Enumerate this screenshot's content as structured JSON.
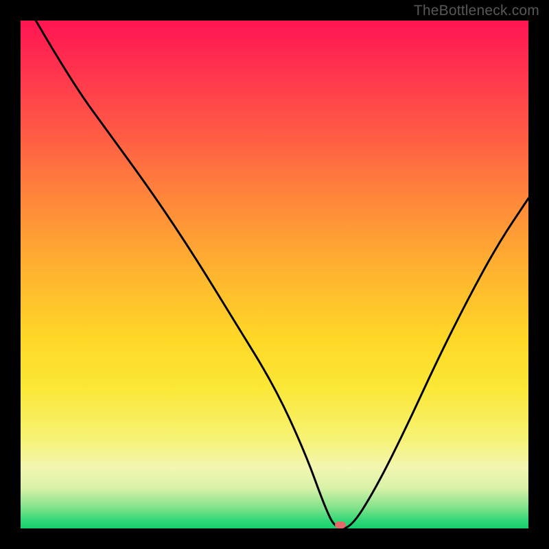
{
  "watermark": "TheBottleneck.com",
  "marker": {
    "x_pct": 63,
    "y_pct": 99.3
  },
  "chart_data": {
    "type": "line",
    "title": "",
    "xlabel": "",
    "ylabel": "",
    "xlim": [
      0,
      100
    ],
    "ylim": [
      0,
      100
    ],
    "background_gradient": {
      "orientation": "vertical",
      "stops": [
        {
          "pct": 0,
          "color": "#ff1552"
        },
        {
          "pct": 22,
          "color": "#ff5a45"
        },
        {
          "pct": 50,
          "color": "#ffb52f"
        },
        {
          "pct": 72,
          "color": "#fbe735"
        },
        {
          "pct": 92,
          "color": "#d9f2a8"
        },
        {
          "pct": 100,
          "color": "#16d06f"
        }
      ]
    },
    "series": [
      {
        "name": "bottleneck-curve",
        "color": "#000000",
        "x": [
          3,
          10,
          18,
          26,
          34,
          42,
          50,
          56,
          60,
          62,
          65,
          70,
          76,
          82,
          88,
          94,
          100
        ],
        "y": [
          100,
          88,
          77,
          66,
          54,
          41,
          28,
          15,
          4,
          0,
          0,
          8,
          20,
          33,
          45,
          56,
          65
        ]
      }
    ],
    "marker_point": {
      "x": 63,
      "y": 0,
      "color": "#e46a6a"
    }
  }
}
